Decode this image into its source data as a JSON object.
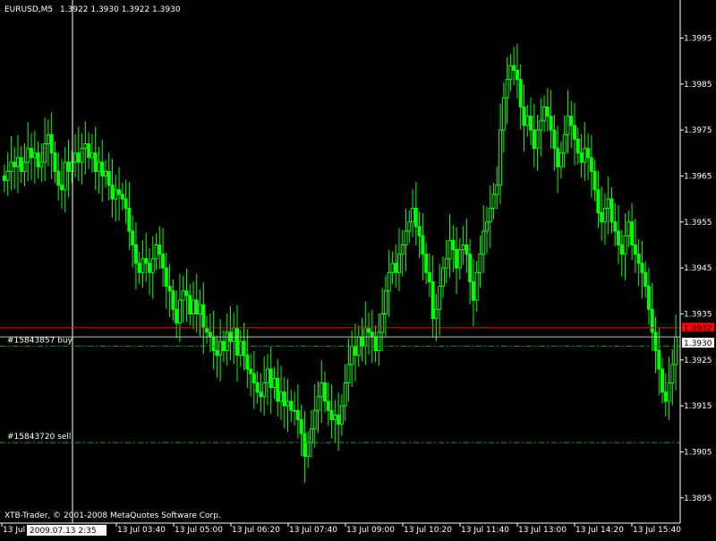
{
  "header": {
    "symbol_timeframe": "EURUSD,M5",
    "ohlc": "1.3922 1.3930 1.3922 1.3930"
  },
  "footer": {
    "copyright": "XTB-Trader, © 2001-2008 MetaQuotes Software Corp."
  },
  "crosshair": {
    "time_label": "2009.07.13 2:35"
  },
  "orders": [
    {
      "label": "#15843857 buy",
      "price": 1.3928
    },
    {
      "label": "#15843720 sell",
      "price": 1.3907
    }
  ],
  "levels": {
    "ask": {
      "label": "1.3932",
      "price": 1.3932
    },
    "bid": {
      "label": "1.3930",
      "price": 1.393
    }
  },
  "colors": {
    "background": "#000000",
    "candle": "#00ff00",
    "foreground": "#ffffff",
    "ask_line": "#ff0000",
    "bid_line": "#c0c0c0",
    "order_line": "#00aa00",
    "ask_label_bg": "#ff0000"
  },
  "chart_data": {
    "type": "candlestick",
    "yticks": [
      1.3995,
      1.3985,
      1.3975,
      1.3965,
      1.3955,
      1.3945,
      1.3935,
      1.3925,
      1.3915,
      1.3905,
      1.3895
    ],
    "ytick_labels": [
      "1.3995",
      "1.3985",
      "1.3975",
      "1.3965",
      "1.3955",
      "1.3945",
      "1.3935",
      "1.3925",
      "1.3915",
      "1.3905",
      "1.3895"
    ],
    "xtick_labels": [
      "13 Jul 200",
      "13 Jul 03:40",
      "13 Jul 05:00",
      "13 Jul 06:20",
      "13 Jul 07:40",
      "13 Jul 09:00",
      "13 Jul 10:20",
      "13 Jul 11:40",
      "13 Jul 13:00",
      "13 Jul 14:20",
      "13 Jul 15:40"
    ],
    "closes": [
      1.3964,
      1.3966,
      1.3968,
      1.3967,
      1.3969,
      1.3966,
      1.3968,
      1.3971,
      1.3969,
      1.397,
      1.3967,
      1.3968,
      1.3972,
      1.3974,
      1.397,
      1.3966,
      1.3963,
      1.3962,
      1.3968,
      1.3966,
      1.3968,
      1.397,
      1.3968,
      1.3971,
      1.3972,
      1.3969,
      1.397,
      1.3966,
      1.3968,
      1.3965,
      1.3966,
      1.3963,
      1.396,
      1.3962,
      1.3961,
      1.396,
      1.3958,
      1.3953,
      1.395,
      1.3946,
      1.3944,
      1.3947,
      1.3946,
      1.3944,
      1.3947,
      1.395,
      1.3948,
      1.3945,
      1.3941,
      1.394,
      1.3936,
      1.3933,
      1.3938,
      1.394,
      1.3939,
      1.3935,
      1.3938,
      1.3935,
      1.3937,
      1.3932,
      1.3931,
      1.393,
      1.3927,
      1.3926,
      1.3929,
      1.3927,
      1.3931,
      1.3929,
      1.3932,
      1.3926,
      1.3929,
      1.3926,
      1.3923,
      1.3922,
      1.392,
      1.3918,
      1.3917,
      1.392,
      1.3923,
      1.3919,
      1.3921,
      1.3916,
      1.3918,
      1.3915,
      1.3916,
      1.3914,
      1.3914,
      1.3912,
      1.3909,
      1.3904,
      1.3907,
      1.391,
      1.3914,
      1.3917,
      1.392,
      1.3916,
      1.3914,
      1.3912,
      1.3913,
      1.3911,
      1.3915,
      1.392,
      1.3924,
      1.3928,
      1.3926,
      1.393,
      1.3928,
      1.3932,
      1.3931,
      1.393,
      1.3927,
      1.3931,
      1.3935,
      1.394,
      1.3944,
      1.3946,
      1.3944,
      1.3948,
      1.395,
      1.3953,
      1.3955,
      1.3958,
      1.3954,
      1.3952,
      1.3948,
      1.3944,
      1.3942,
      1.3934,
      1.3936,
      1.3941,
      1.3945,
      1.3947,
      1.3951,
      1.3949,
      1.3945,
      1.3949,
      1.395,
      1.3948,
      1.3942,
      1.3938,
      1.3944,
      1.3948,
      1.3953,
      1.3955,
      1.3958,
      1.3961,
      1.3963,
      1.3975,
      1.3982,
      1.3986,
      1.3989,
      1.3988,
      1.3986,
      1.398,
      1.3976,
      1.3978,
      1.3975,
      1.3971,
      1.3975,
      1.3977,
      1.398,
      1.3978,
      1.3975,
      1.3971,
      1.3967,
      1.397,
      1.3974,
      1.3978,
      1.3976,
      1.3973,
      1.397,
      1.3968,
      1.3971,
      1.3969,
      1.3966,
      1.3962,
      1.3957,
      1.3955,
      1.3958,
      1.396,
      1.3955,
      1.3953,
      1.395,
      1.3948,
      1.3952,
      1.3955,
      1.395,
      1.3948,
      1.3946,
      1.3944,
      1.3941,
      1.3936,
      1.3931,
      1.3927,
      1.3923,
      1.3918,
      1.3916,
      1.392,
      1.3924,
      1.393
    ]
  }
}
